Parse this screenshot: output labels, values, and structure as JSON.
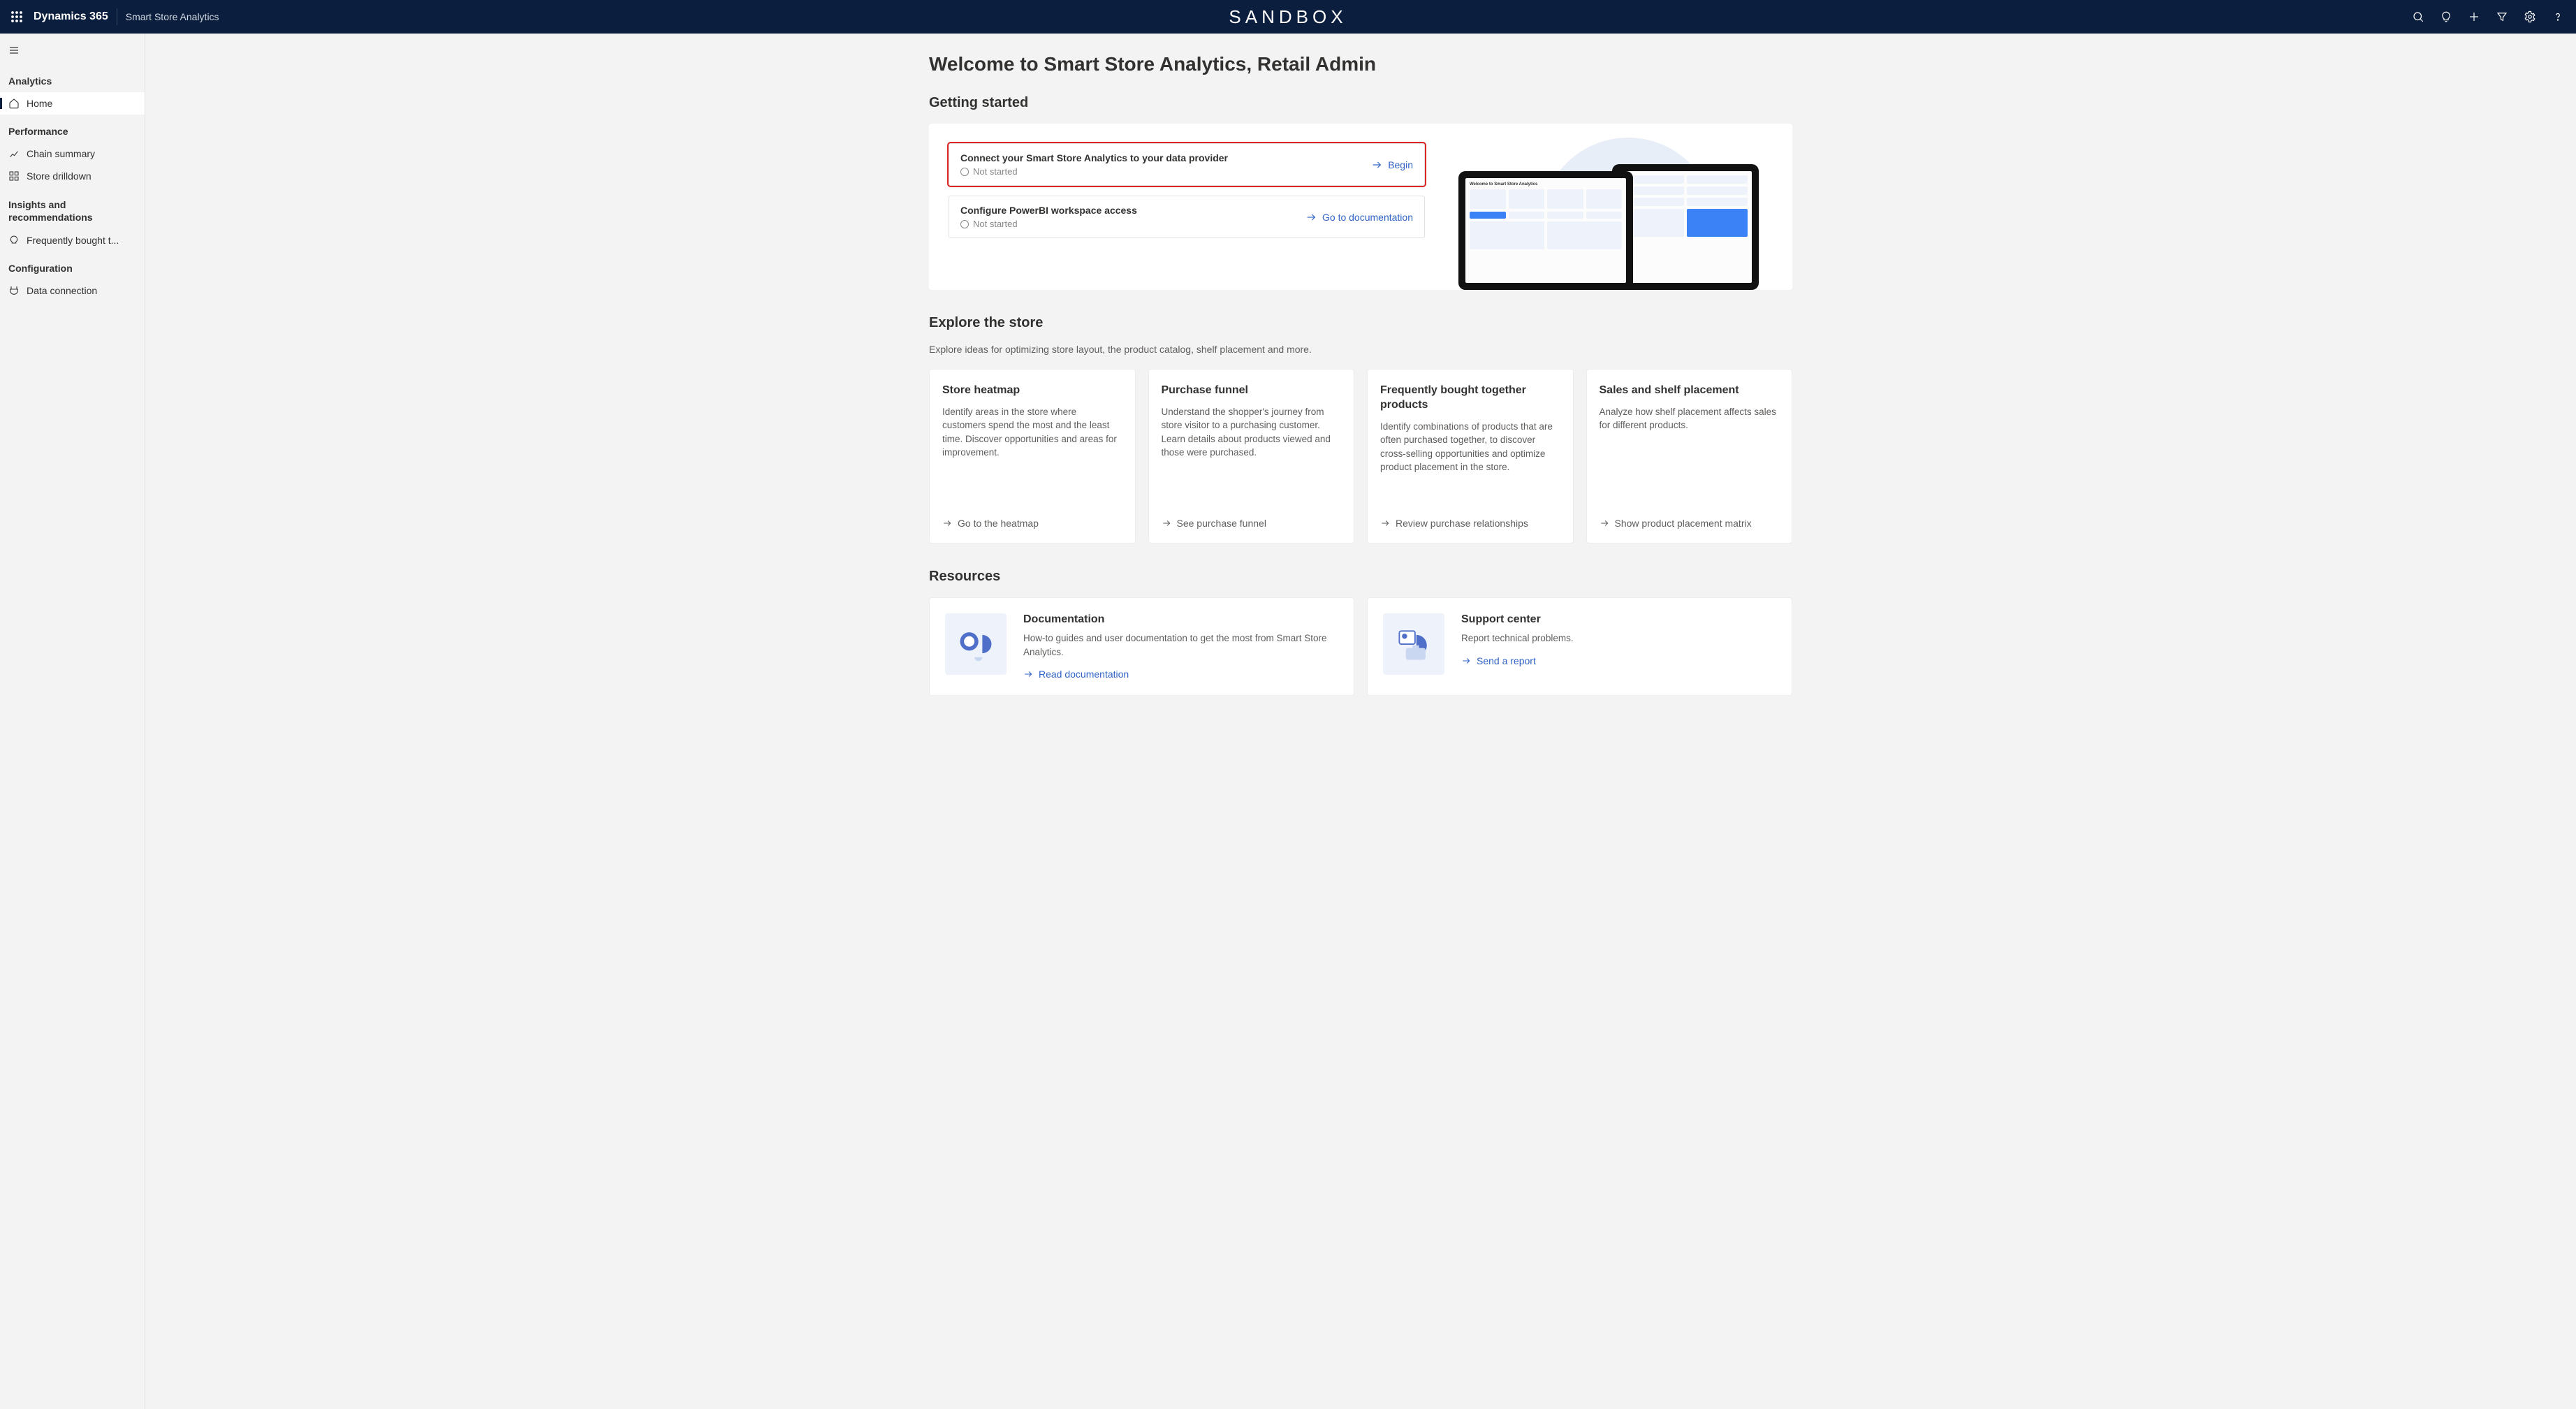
{
  "topbar": {
    "brand": "Dynamics 365",
    "app_name": "Smart Store Analytics",
    "env_label": "SANDBOX"
  },
  "sidebar": {
    "groups": [
      {
        "label": "Analytics",
        "items": [
          {
            "label": "Home",
            "icon": "home",
            "active": true
          }
        ]
      },
      {
        "label": "Performance",
        "items": [
          {
            "label": "Chain summary",
            "icon": "chart"
          },
          {
            "label": "Store drilldown",
            "icon": "grid"
          }
        ]
      },
      {
        "label": "Insights and recommendations",
        "items": [
          {
            "label": "Frequently bought t...",
            "icon": "bulb"
          }
        ]
      },
      {
        "label": "Configuration",
        "items": [
          {
            "label": "Data connection",
            "icon": "plug"
          }
        ]
      }
    ]
  },
  "page": {
    "title": "Welcome to Smart Store Analytics, Retail Admin",
    "getting_started": {
      "heading": "Getting started",
      "rows": [
        {
          "title": "Connect your Smart Store Analytics to your data provider",
          "status": "Not started",
          "action": "Begin",
          "highlight": true
        },
        {
          "title": "Configure PowerBI workspace access",
          "status": "Not started",
          "action": "Go to documentation",
          "highlight": false
        }
      ]
    },
    "explore": {
      "heading": "Explore the store",
      "sub": "Explore ideas for optimizing store layout, the product catalog, shelf placement and more.",
      "cards": [
        {
          "title": "Store heatmap",
          "desc": "Identify areas in the store where customers spend the most and the least time. Discover opportunities and areas for improvement.",
          "link": "Go to the heatmap"
        },
        {
          "title": "Purchase funnel",
          "desc": "Understand the shopper's journey from store visitor to a purchasing customer. Learn details about products viewed and those were purchased.",
          "link": "See purchase funnel"
        },
        {
          "title": "Frequently bought together products",
          "desc": "Identify combinations of products that are often purchased together, to discover cross-selling opportunities and optimize product placement in the store.",
          "link": "Review purchase relationships"
        },
        {
          "title": "Sales and shelf placement",
          "desc": "Analyze how shelf placement affects sales for different products.",
          "link": "Show product placement matrix"
        }
      ]
    },
    "resources": {
      "heading": "Resources",
      "cards": [
        {
          "title": "Documentation",
          "desc": "How-to guides and user documentation to get the most from Smart Store Analytics.",
          "link": "Read documentation"
        },
        {
          "title": "Support center",
          "desc": "Report technical problems.",
          "link": "Send a report"
        }
      ]
    }
  }
}
